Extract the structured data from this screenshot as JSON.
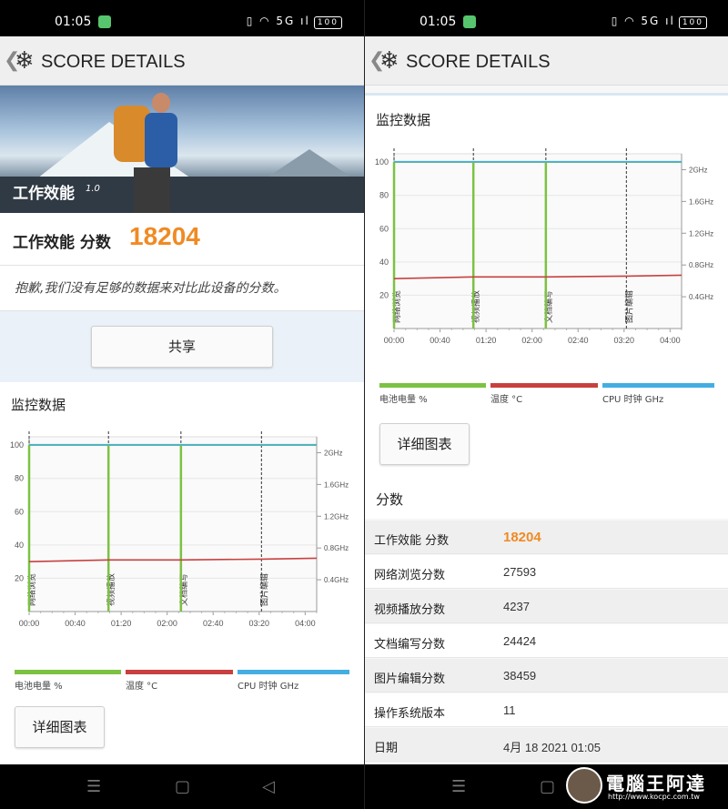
{
  "status_bar": {
    "time": "01:05",
    "icons": "▯ ◠ 5G ıl",
    "battery": "100"
  },
  "app_bar": {
    "title": "SCORE DETAILS",
    "back_icon": "chevron-left-icon",
    "logo_icon": "snowflake-icon"
  },
  "hero": {
    "title": "工作效能",
    "version": "1.0"
  },
  "score": {
    "label": "工作效能 分数",
    "value": "18204"
  },
  "notice": "抱歉,我们没有足够的数据来对比此设备的分数。",
  "share_button": "共享",
  "monitor": {
    "heading": "监控数据",
    "detail_button": "详细图表",
    "legend": [
      {
        "label": "电池电量 %",
        "color": "#7cc243"
      },
      {
        "label": "温度 °C",
        "color": "#c8403f"
      },
      {
        "label": "CPU 时钟 GHz",
        "color": "#44aee2"
      }
    ]
  },
  "chart_data": {
    "type": "line",
    "xlabel": "",
    "ylabel": "",
    "x_ticks": [
      "00:00",
      "00:40",
      "01:20",
      "02:00",
      "02:40",
      "03:20",
      "04:00"
    ],
    "x_range_minutes": [
      0,
      250
    ],
    "y_left_ticks": [
      20,
      40,
      60,
      80,
      100
    ],
    "y_left_range": [
      0,
      105
    ],
    "y_right_ticks": [
      "0.4GHz",
      "0.8GHz",
      "1.2GHz",
      "1.6GHz",
      "2GHz"
    ],
    "y_right_values": [
      0.4,
      0.8,
      1.2,
      1.6,
      2.0
    ],
    "y_right_range": [
      0,
      2.2
    ],
    "segments": [
      {
        "label": "网络浏览",
        "start_min": 0
      },
      {
        "label": "视频播放",
        "start_min": 69
      },
      {
        "label": "文档编写",
        "start_min": 132
      },
      {
        "label": "图片编辑",
        "start_min": 202
      }
    ],
    "series": [
      {
        "name": "电池电量 %",
        "color": "#7cc243",
        "values": [
          [
            0,
            100
          ],
          [
            250,
            100
          ]
        ]
      },
      {
        "name": "温度 °C",
        "color": "#c8403f",
        "values": [
          [
            0,
            30
          ],
          [
            69,
            31
          ],
          [
            132,
            31
          ],
          [
            202,
            31.5
          ],
          [
            250,
            32
          ]
        ]
      },
      {
        "name": "CPU 时钟 GHz",
        "color": "#44aee2",
        "values": [
          [
            0,
            2.1
          ],
          [
            250,
            2.1
          ]
        ]
      }
    ]
  },
  "scores": {
    "heading": "分数",
    "rows": [
      {
        "label": "工作效能 分数",
        "value": "18204",
        "highlight": true
      },
      {
        "label": "网络浏览分数",
        "value": "27593"
      },
      {
        "label": "视频播放分数",
        "value": "4237"
      },
      {
        "label": "文档编写分数",
        "value": "24424"
      },
      {
        "label": "图片编辑分数",
        "value": "38459"
      },
      {
        "label": "操作系统版本",
        "value": "11"
      },
      {
        "label": "日期",
        "value": "4月 18 2021 01:05"
      }
    ]
  },
  "nav_bar": {
    "menu": "☰",
    "home": "▢",
    "back": "◁"
  },
  "watermark": {
    "text": "電腦王阿達",
    "url": "http://www.kocpc.com.tw"
  }
}
